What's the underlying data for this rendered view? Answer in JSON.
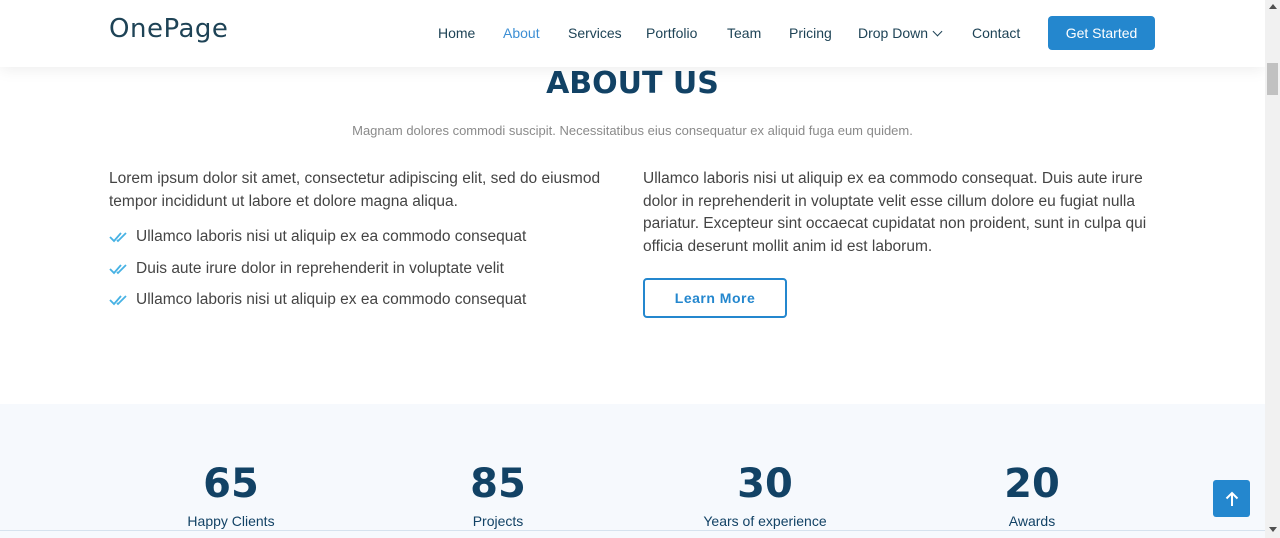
{
  "header": {
    "logo": "OnePage",
    "nav": [
      {
        "label": "Home"
      },
      {
        "label": "About"
      },
      {
        "label": "Services"
      },
      {
        "label": "Portfolio"
      },
      {
        "label": "Team"
      },
      {
        "label": "Pricing"
      },
      {
        "label": "Drop Down"
      },
      {
        "label": "Contact"
      }
    ],
    "active_nav": "About",
    "cta_label": "Get Started"
  },
  "about": {
    "title": "ABOUT US",
    "subtitle": "Magnam dolores commodi suscipit. Necessitatibus eius consequatur ex aliquid fuga eum quidem.",
    "left_text": "Lorem ipsum dolor sit amet, consectetur adipiscing elit, sed do eiusmod tempor incididunt ut labore et dolore magna aliqua.",
    "checklist": [
      "Ullamco laboris nisi ut aliquip ex ea commodo consequat",
      "Duis aute irure dolor in reprehenderit in voluptate velit",
      "Ullamco laboris nisi ut aliquip ex ea commodo consequat"
    ],
    "right_text": "Ullamco laboris nisi ut aliquip ex ea commodo consequat. Duis aute irure dolor in reprehenderit in voluptate velit esse cillum dolore eu fugiat nulla pariatur. Excepteur sint occaecat cupidatat non proident, sunt in culpa qui officia deserunt mollit anim id est laborum.",
    "button_label": "Learn More"
  },
  "counts": [
    {
      "number": "65",
      "label": "Happy Clients"
    },
    {
      "number": "85",
      "label": "Projects"
    },
    {
      "number": "30",
      "label": "Years of experience"
    },
    {
      "number": "20",
      "label": "Awards"
    }
  ],
  "icons": {
    "check": "double-check-icon",
    "back_to_top": "arrow-up-icon",
    "dropdown": "chevron-down-icon"
  },
  "colors": {
    "accent": "#2487ce",
    "heading": "#124265",
    "counts_background": "#f6f9fd"
  }
}
